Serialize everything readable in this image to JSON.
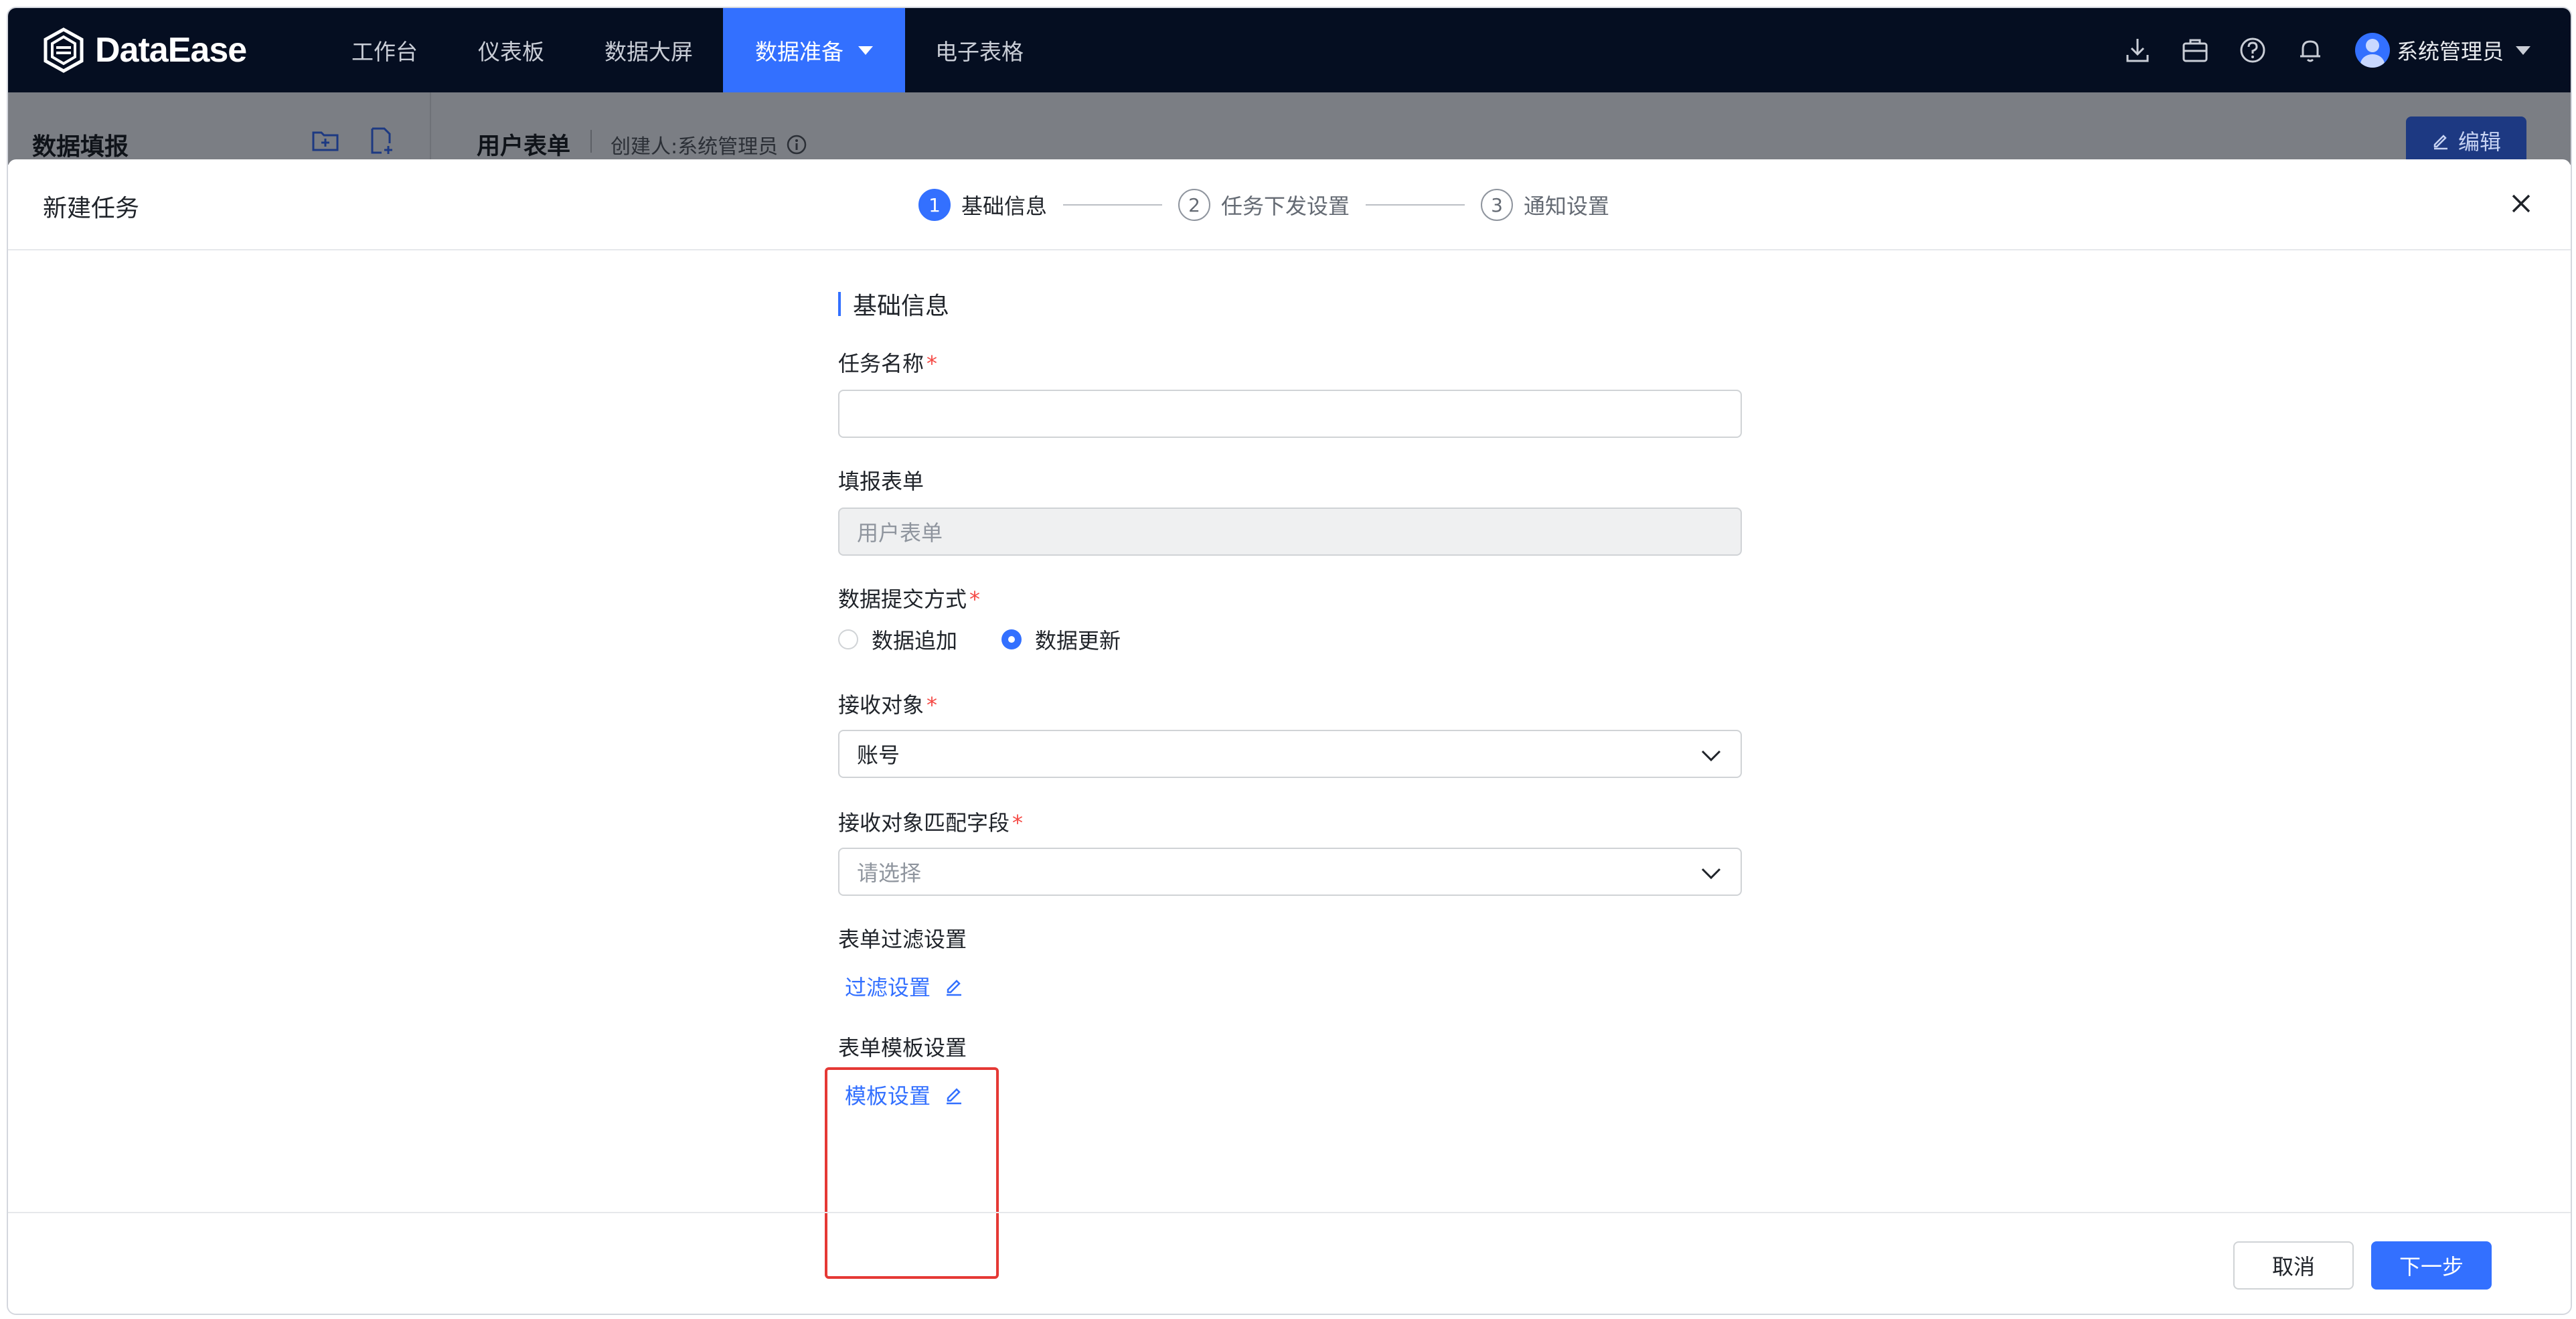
{
  "app": {
    "name": "DataEase"
  },
  "nav": {
    "items": [
      {
        "label": "工作台"
      },
      {
        "label": "仪表板"
      },
      {
        "label": "数据大屏"
      },
      {
        "label": "数据准备",
        "active": true
      },
      {
        "label": "电子表格"
      }
    ],
    "icons": [
      "download-icon",
      "briefcase-icon",
      "help-icon",
      "bell-icon"
    ],
    "user": "系统管理员",
    "accent": "#3370ff",
    "background": "#050e21"
  },
  "underlying": {
    "left_title": "数据填报",
    "form_name": "用户表单",
    "creator": "创建人:系统管理员",
    "edit_label": "编辑"
  },
  "drawer": {
    "title": "新建任务",
    "steps": [
      {
        "num": "1",
        "label": "基础信息",
        "active": true
      },
      {
        "num": "2",
        "label": "任务下发设置"
      },
      {
        "num": "3",
        "label": "通知设置"
      }
    ],
    "section_title": "基础信息",
    "fields": {
      "task_name": {
        "label": "任务名称",
        "value": ""
      },
      "form": {
        "label": "填报表单",
        "value": "用户表单"
      },
      "submit_mode": {
        "label": "数据提交方式",
        "options": [
          "数据追加",
          "数据更新"
        ],
        "selected": "数据更新"
      },
      "receiver": {
        "label": "接收对象",
        "value": "账号"
      },
      "match_field": {
        "label": "接收对象匹配字段",
        "placeholder": "请选择"
      },
      "filter": {
        "label": "表单过滤设置",
        "link": "过滤设置"
      },
      "template": {
        "label": "表单模板设置",
        "link": "模板设置"
      }
    },
    "footer": {
      "cancel": "取消",
      "next": "下一步"
    }
  }
}
